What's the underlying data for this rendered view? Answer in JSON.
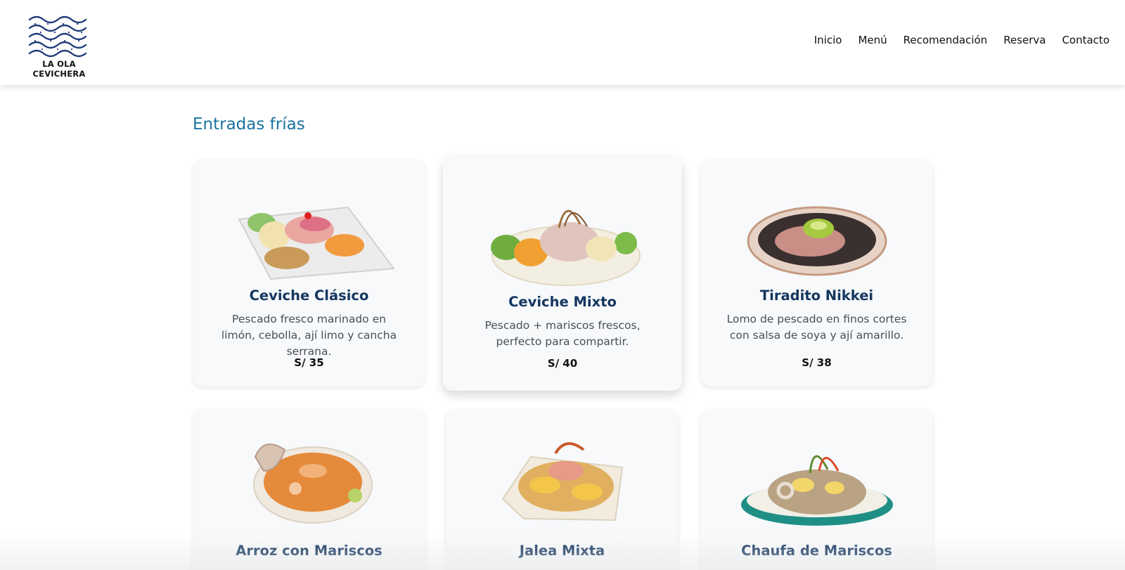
{
  "brand": {
    "name": "LA OLA CEVICHERA"
  },
  "nav": {
    "items": [
      {
        "label": "Inicio"
      },
      {
        "label": "Menú"
      },
      {
        "label": "Recomendación"
      },
      {
        "label": "Reserva"
      },
      {
        "label": "Contacto"
      }
    ]
  },
  "section": {
    "title": "Entradas frías"
  },
  "dishes": [
    {
      "name": "Ceviche Clásico",
      "description": "Pescado fresco marinado en limón, cebolla, ají limo y cancha serrana.",
      "price": "S/ 35"
    },
    {
      "name": "Ceviche Mixto",
      "description": "Pescado + mariscos frescos, perfecto para compartir.",
      "price": "S/ 40"
    },
    {
      "name": "Tiradito Nikkei",
      "description": "Lomo de pescado en finos cortes con salsa de soya y ají amarillo.",
      "price": "S/ 38"
    },
    {
      "name": "Arroz con Mariscos"
    },
    {
      "name": "Jalea Mixta"
    },
    {
      "name": "Chaufa de Mariscos"
    }
  ],
  "colors": {
    "accent": "#1a73a0",
    "title": "#14365f",
    "card_bg": "#f7f9fb",
    "logo": "#1f3b7a"
  }
}
